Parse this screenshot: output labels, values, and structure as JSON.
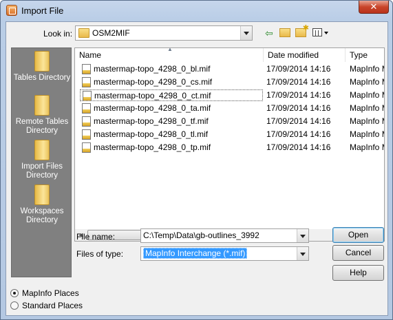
{
  "window": {
    "title": "Import File",
    "close_label": "✕"
  },
  "lookin": {
    "label": "Look in:",
    "value": "OSM2MIF"
  },
  "toolbar": {
    "back_glyph": "⇦",
    "views_label": "Views"
  },
  "places": [
    {
      "label": "Tables Directory"
    },
    {
      "label": "Remote Tables Directory"
    },
    {
      "label": "Import Files Directory"
    },
    {
      "label": "Workspaces Directory"
    }
  ],
  "columns": {
    "name": "Name",
    "date": "Date modified",
    "type": "Type"
  },
  "files": [
    {
      "name": "mastermap-topo_4298_0_bl.mif",
      "date": "17/09/2014 14:16",
      "type": "MapInfo M"
    },
    {
      "name": "mastermap-topo_4298_0_cs.mif",
      "date": "17/09/2014 14:16",
      "type": "MapInfo M"
    },
    {
      "name": "mastermap-topo_4298_0_ct.mif",
      "date": "17/09/2014 14:16",
      "type": "MapInfo M"
    },
    {
      "name": "mastermap-topo_4298_0_ta.mif",
      "date": "17/09/2014 14:16",
      "type": "MapInfo M"
    },
    {
      "name": "mastermap-topo_4298_0_tf.mif",
      "date": "17/09/2014 14:16",
      "type": "MapInfo M"
    },
    {
      "name": "mastermap-topo_4298_0_tl.mif",
      "date": "17/09/2014 14:16",
      "type": "MapInfo M"
    },
    {
      "name": "mastermap-topo_4298_0_tp.mif",
      "date": "17/09/2014 14:16",
      "type": "MapInfo M"
    }
  ],
  "selected_file_index": 2,
  "filename": {
    "label": "File name:",
    "value": "C:\\Temp\\Data\\gb-outlines_3992"
  },
  "filetype": {
    "label": "Files of type:",
    "value": "MapInfo Interchange (*.mif)"
  },
  "buttons": {
    "open": "Open",
    "cancel": "Cancel",
    "help": "Help"
  },
  "place_options": {
    "mapinfo": "MapInfo Places",
    "standard": "Standard Places",
    "selected": "mapinfo"
  }
}
